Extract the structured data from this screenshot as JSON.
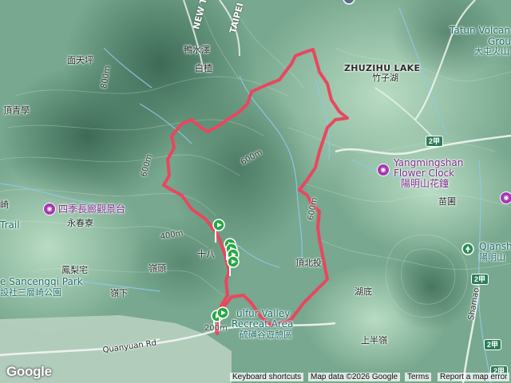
{
  "map": {
    "attribution": {
      "logo": "Google",
      "keyboard_shortcuts": "Keyboard shortcuts",
      "map_data": "Map data ©2026 Google",
      "terms": "Terms",
      "report": "Report a map error"
    },
    "labels": {
      "new_taipei": "NEW T",
      "taipei": "TAIPEI",
      "yazishui": "鴨水澤",
      "baigen": "白楂",
      "miantianping": "面天坪",
      "dingqingxue": "頂青學",
      "zhuzihu_en": "ZHUZIHU LAKE",
      "zhuzihu_zh": "竹子湖",
      "tatun_en": "Tatun Volcan",
      "tatun_group": "Grou",
      "datun_zh": "大屯火山",
      "flower_clock_en1": "Yangmingshan",
      "flower_clock_en2": "Flower Clock",
      "flower_clock_zh": "陽明山花鐘",
      "miaopu": "苗圃",
      "qianshan_en": "Qiansh",
      "qianshan_zh": "陽明山",
      "four_seasons": "四季長廊觀景台",
      "yongchunliao": "永春寮",
      "trail": "Trail",
      "qi": "崎",
      "fenglizhai": "鳳梨宅",
      "lingtou": "嶺頭",
      "sancengqi_en": "e Sancengqi Park",
      "sancengqi_zh": "設社三層崎公園",
      "lingxia": "嶺下",
      "dingbeitou": "頂北投",
      "hudi": "湖底",
      "shangbanling": "上半嶺",
      "sulfur_en1": "ulfur Valley",
      "sulfur_en2": "Recreat   Area",
      "sulfur_zh": "硫磺谷遊憩區",
      "quanyuan": "Quanyuan Rd",
      "shamao": "Shamao Rd",
      "shiba": "十八",
      "c600a": "600m",
      "c600b": "600m",
      "c600c": "600m",
      "c400": "400m",
      "c200": "200m",
      "c800": "800m"
    },
    "route_shields": [
      "2甲",
      "2甲",
      "2甲",
      "2甲"
    ],
    "icons": {
      "poi_photo": "camera-icon",
      "poi_park": "tree-icon",
      "waypoint": "flag-pin-icon"
    },
    "colors": {
      "track": "#e8475e",
      "water": "#86c4e6",
      "terrain_dark": "#3f6f58",
      "terrain_light": "#a9cfb6",
      "poi_purple": "#a43ab0",
      "pin_green": "#27a744"
    }
  }
}
